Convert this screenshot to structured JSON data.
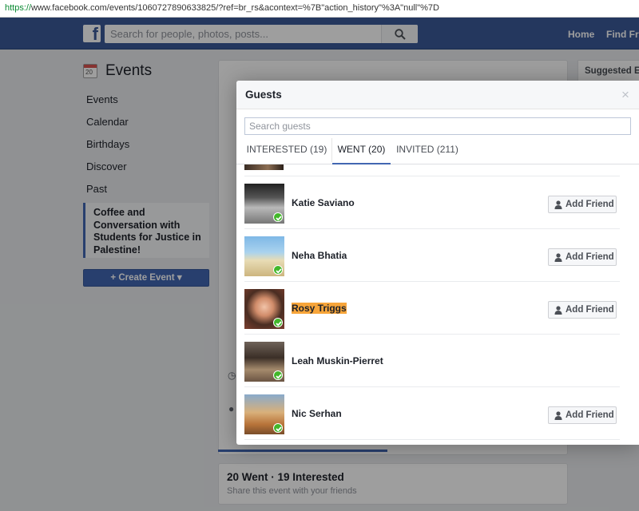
{
  "browser": {
    "url_scheme": "https://",
    "url_rest": "www.facebook.com/events/1060727890633825/?ref=br_rs&acontext=%7B\"action_history\"%3A\"null\"%7D"
  },
  "topbar": {
    "logo_letter": "f",
    "search_placeholder": "Search for people, photos, posts...",
    "home_label": "Home",
    "find_friends_label": "Find Frie"
  },
  "sidebar": {
    "title": "Events",
    "calendar_icon_day": "20",
    "items": [
      {
        "label": "Events"
      },
      {
        "label": "Calendar"
      },
      {
        "label": "Birthdays"
      },
      {
        "label": "Discover"
      },
      {
        "label": "Past"
      }
    ],
    "selected_event": "Coffee and Conversation with Students for Justice in Palestine!",
    "create_button": "+ Create Event ▾"
  },
  "right_column": {
    "suggested_label": "Suggested Ev"
  },
  "summary": {
    "went_interested": "20 Went · 19 Interested",
    "share_text": "Share this event with your friends"
  },
  "dialog": {
    "title": "Guests",
    "close_symbol": "×",
    "search_placeholder": "Search guests",
    "tabs": [
      {
        "label": "INTERESTED (19)",
        "active": false
      },
      {
        "label": "WENT (20)",
        "active": true
      },
      {
        "label": "INVITED (211)",
        "active": false
      }
    ],
    "guests": [
      {
        "name": "Katie Saviano",
        "highlighted": false,
        "show_add_friend": true,
        "add_friend_label": "Add Friend"
      },
      {
        "name": "Neha Bhatia",
        "highlighted": false,
        "show_add_friend": true,
        "add_friend_label": "Add Friend"
      },
      {
        "name": "Rosy Triggs",
        "highlighted": true,
        "show_add_friend": true,
        "add_friend_label": "Add Friend"
      },
      {
        "name": "Leah Muskin-Pierret",
        "highlighted": false,
        "show_add_friend": false,
        "add_friend_label": ""
      },
      {
        "name": "Nic Serhan",
        "highlighted": false,
        "show_add_friend": true,
        "add_friend_label": "Add Friend"
      }
    ]
  },
  "colors": {
    "brand_blue": "#3b5998",
    "accent_blue": "#4267b2",
    "went_check": "#42b72a",
    "highlight": "#f7a53a"
  }
}
